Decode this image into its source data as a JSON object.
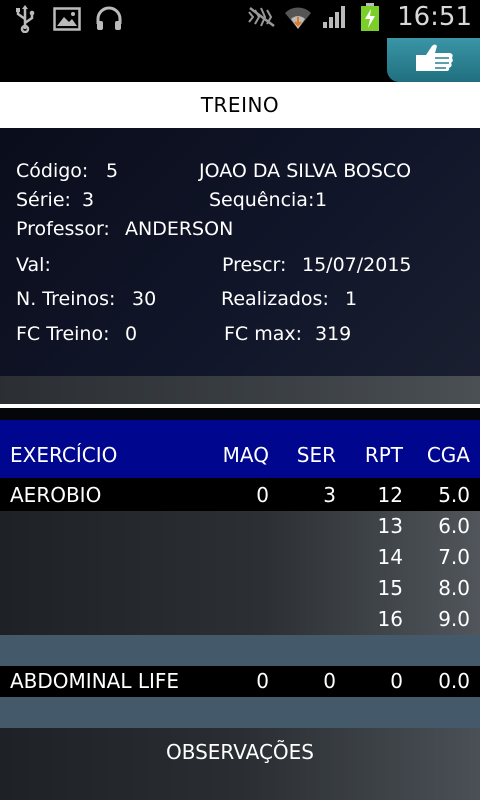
{
  "status_bar": {
    "time": "16:51",
    "icons": [
      "usb-icon",
      "image-icon",
      "headset-icon",
      "mute-icon",
      "wifi-icon",
      "signal-icon",
      "battery-charging-icon"
    ]
  },
  "header": {
    "title": "TREINO",
    "action_icon": "thumbs-up-icon"
  },
  "info": {
    "codigo_label": "Código:",
    "codigo_value": "5",
    "name": "JOAO DA SILVA BOSCO",
    "serie_label": "Série:",
    "serie_value": "3",
    "sequencia_label": "Sequência:",
    "sequencia_value": "1",
    "professor_label": "Professor:",
    "professor_value": "ANDERSON",
    "val_label": "Val:",
    "val_value": "",
    "prescr_label": "Prescr:",
    "prescr_value": "15/07/2015",
    "ntreinos_label": "N. Treinos:",
    "ntreinos_value": "30",
    "realizados_label": "Realizados:",
    "realizados_value": "1",
    "fctreino_label": "FC Treino:",
    "fctreino_value": "0",
    "fcmax_label": "FC max:",
    "fcmax_value": "319"
  },
  "table": {
    "headers": [
      "EXERCÍCIO",
      "MAQ",
      "SER",
      "RPT",
      "CGA"
    ],
    "exercises": [
      {
        "name": "AEROBIO",
        "maq": "0",
        "ser": "3",
        "sets": [
          {
            "rpt": "12",
            "cga": "5.0"
          },
          {
            "rpt": "13",
            "cga": "6.0"
          },
          {
            "rpt": "14",
            "cga": "7.0"
          },
          {
            "rpt": "15",
            "cga": "8.0"
          },
          {
            "rpt": "16",
            "cga": "9.0"
          }
        ]
      },
      {
        "name": "ABDOMINAL LIFE",
        "maq": "0",
        "ser": "0",
        "sets": [
          {
            "rpt": "0",
            "cga": "0.0"
          }
        ]
      }
    ]
  },
  "footer": {
    "observacoes": "OBSERVAÇÕES"
  }
}
